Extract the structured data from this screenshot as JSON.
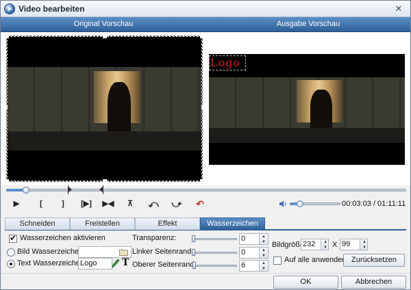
{
  "window": {
    "title": "Video bearbeiten",
    "close_glyph": "✕"
  },
  "preview": {
    "original_label": "Original Vorschau",
    "output_label": "Ausgabe Vorschau"
  },
  "watermark_preview": {
    "text": "Logo",
    "color": "#d41a1a"
  },
  "playback": {
    "position_fraction": 0.05,
    "volume_fraction": 0.2,
    "current_time": "00:03:03",
    "separator": " / ",
    "total_time": "01:11:11",
    "buttons": [
      {
        "name": "play-icon",
        "glyph": "▶"
      },
      {
        "name": "mark-in-icon",
        "glyph": "["
      },
      {
        "name": "mark-out-icon",
        "glyph": "]"
      },
      {
        "name": "play-selection-icon",
        "glyph": "[▶]"
      },
      {
        "name": "go-to-start-icon",
        "glyph": "▶◀"
      },
      {
        "name": "split-icon",
        "glyph": "⊼"
      },
      {
        "name": "rotate-left-icon",
        "glyph": "⤺"
      },
      {
        "name": "rotate-right-icon",
        "glyph": "⤻"
      },
      {
        "name": "undo-icon",
        "glyph": "↶"
      }
    ]
  },
  "tabs": [
    {
      "label": "Schneiden",
      "active": false
    },
    {
      "label": "Freistellen",
      "active": false
    },
    {
      "label": "Effekt",
      "active": false
    },
    {
      "label": "Wasserzeichen",
      "active": true
    }
  ],
  "watermark": {
    "enable_label": "Wasserzeichen aktivieren",
    "enable_checked": true,
    "image_label": "Bild Wasserzeichen:",
    "image_value": "",
    "text_label": "Text Wasserzeichen:",
    "text_value": "Logo",
    "selected_mode": "text",
    "transparency_label": "Transparenz:",
    "transparency_value": "0",
    "left_margin_label": "Linker Seitenrand:",
    "left_margin_value": "0",
    "top_margin_label": "Oberer Seitenrand:",
    "top_margin_value": "6",
    "size_label": "Bildgröße:",
    "width_value": "232",
    "size_separator": "X",
    "height_value": "99",
    "apply_all_label": "Auf alle anwenden",
    "apply_all_checked": false,
    "reset_label": "Zurücksetzen"
  },
  "footer": {
    "ok_label": "OK",
    "cancel_label": "Abbrechen"
  }
}
